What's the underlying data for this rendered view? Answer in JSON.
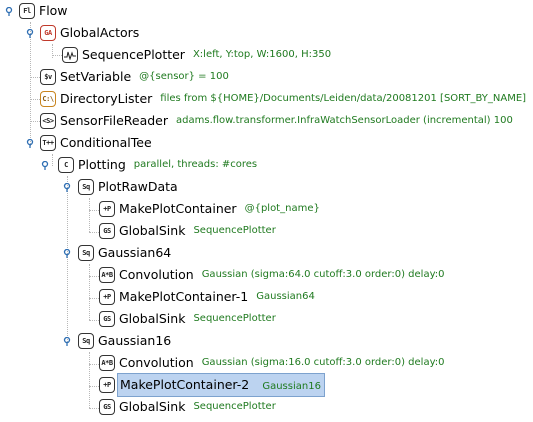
{
  "tree": {
    "root": {
      "label": "Flow",
      "icon": "Fl"
    },
    "global_actors": {
      "label": "GlobalActors",
      "icon": "GA"
    },
    "sequence_plotter": {
      "label": "SequencePlotter",
      "options": "X:left, Y:top, W:1600, H:350"
    },
    "set_variable": {
      "label": "SetVariable",
      "icon": "$v",
      "options": "@{sensor} = 100"
    },
    "directory_lister": {
      "label": "DirectoryLister",
      "icon": "C:\\",
      "options": "files from ${HOME}/Documents/Leiden/data/20081201 [SORT_BY_NAME]"
    },
    "sensor_file_reader": {
      "label": "SensorFileReader",
      "icon": "<S>",
      "options": "adams.flow.transformer.InfraWatchSensorLoader (incremental) 100"
    },
    "conditional_tee": {
      "label": "ConditionalTee",
      "icon": "T++"
    },
    "plotting": {
      "label": "Plotting",
      "icon": "C",
      "options": "parallel, threads: #cores"
    },
    "plot_raw_data": {
      "label": "PlotRawData",
      "icon": "Sq"
    },
    "make_plot_container": {
      "label": "MakePlotContainer",
      "icon": "+P",
      "options": "@{plot_name}"
    },
    "global_sink_1": {
      "label": "GlobalSink",
      "icon": "GS",
      "options": "SequencePlotter"
    },
    "gaussian64": {
      "label": "Gaussian64",
      "icon": "Sq"
    },
    "convolution_1": {
      "label": "Convolution",
      "icon": "A*B",
      "options": "Gaussian (sigma:64.0 cutoff:3.0 order:0) delay:0"
    },
    "make_plot_container_1": {
      "label": "MakePlotContainer-1",
      "icon": "+P",
      "options": "Gaussian64"
    },
    "global_sink_2": {
      "label": "GlobalSink",
      "icon": "GS",
      "options": "SequencePlotter"
    },
    "gaussian16": {
      "label": "Gaussian16",
      "icon": "Sq"
    },
    "convolution_2": {
      "label": "Convolution",
      "icon": "A*B",
      "options": "Gaussian (sigma:16.0 cutoff:3.0 order:0) delay:0"
    },
    "make_plot_container_2": {
      "label": "MakePlotContainer-2",
      "icon": "+P",
      "options": "Gaussian16"
    },
    "global_sink_3": {
      "label": "GlobalSink",
      "icon": "GS",
      "options": "SequencePlotter"
    }
  },
  "colors": {
    "options_text": "#1f7a1f",
    "selection_bg": "#bcd3f0",
    "toggle": "#2f6fb3"
  }
}
